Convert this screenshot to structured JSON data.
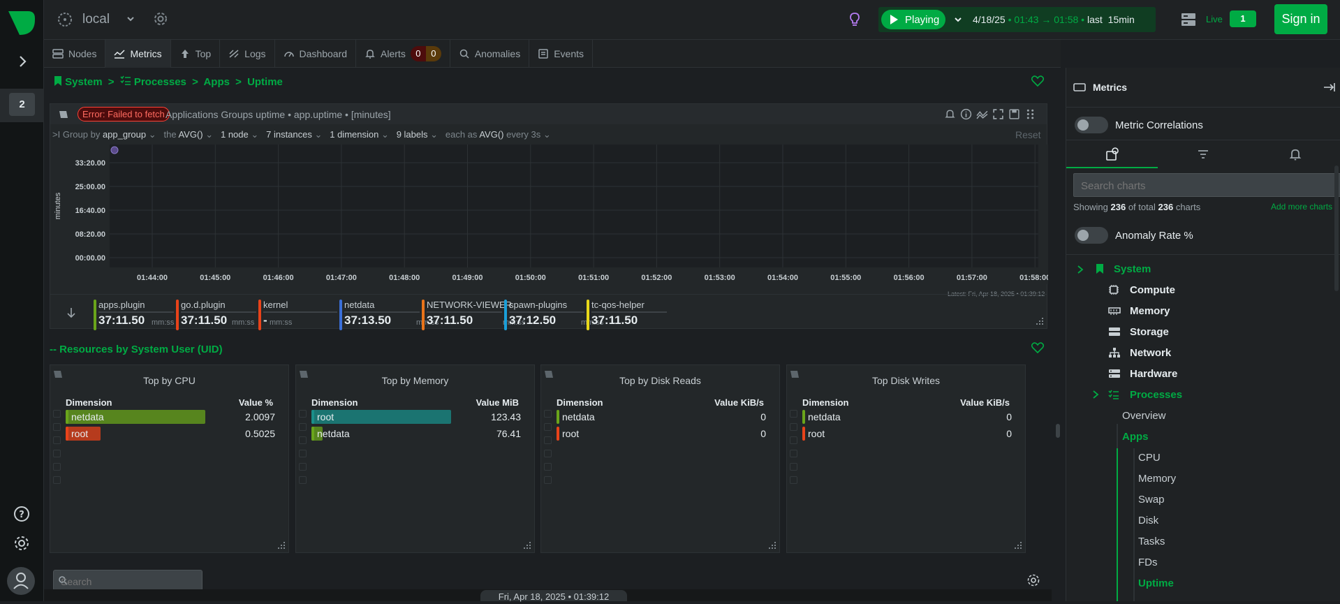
{
  "app": {
    "space_count": "2",
    "room_name": "local",
    "playing_label": "Playing",
    "time_range": {
      "date": "4/18/25",
      "start": "01:43",
      "end": "01:58",
      "last": "last",
      "duration": "15min"
    },
    "live_label": "Live",
    "live_count": "1",
    "signin_label": "Sign in"
  },
  "tabs": [
    {
      "label": "Nodes",
      "icon": "nodes-icon"
    },
    {
      "label": "Metrics",
      "icon": "metrics-icon"
    },
    {
      "label": "Top",
      "icon": "top-icon"
    },
    {
      "label": "Logs",
      "icon": "logs-icon"
    },
    {
      "label": "Dashboard",
      "icon": "dashboard-icon"
    },
    {
      "label": "Alerts",
      "icon": "bell-icon",
      "critical": "0",
      "warning": "0"
    },
    {
      "label": "Anomalies",
      "icon": "anomalies-icon"
    },
    {
      "label": "Events",
      "icon": "events-icon"
    }
  ],
  "breadcrumb": {
    "system": "System",
    "processes": "Processes",
    "apps": "Apps",
    "uptime": "Uptime"
  },
  "chart": {
    "error": "Error: Failed to fetch",
    "title": "Applications Groups uptime • app.uptime • [minutes]",
    "toolbar": {
      "group_by_prefix": "Group by",
      "group_by": "app_group",
      "agg_prefix": "the",
      "agg": "AVG()",
      "nodes": "1 node",
      "instances": "7 instances",
      "dimensions": "1 dimension",
      "labels": "9 labels",
      "each_as_prefix": "each as",
      "each_as": "AVG()",
      "every": "every 3s",
      "reset": "Reset"
    },
    "latest": "Latest:  Fri, Apr 18, 2025 • 01:39:12",
    "legend_unit": "mm:ss",
    "legend": [
      {
        "name": "apps.plugin",
        "value": "37:11.50",
        "color": "#6aa51b"
      },
      {
        "name": "go.d.plugin",
        "value": "37:11.50",
        "color": "#e8431a"
      },
      {
        "name": "kernel",
        "value": "-",
        "color": "#e8431a"
      },
      {
        "name": "netdata",
        "value": "37:13.50",
        "color": "#3a6fd8"
      },
      {
        "name": "NETWORK-VIEWER",
        "value": "37:11.50",
        "color": "#e8731a"
      },
      {
        "name": "spawn-plugins",
        "value": "37:12.50",
        "color": "#1a9fd8"
      },
      {
        "name": "tc-qos-helper",
        "value": "37:11.50",
        "color": "#e8d81a"
      }
    ]
  },
  "chart_data": {
    "type": "line",
    "title": "Applications Groups uptime • app.uptime • [minutes]",
    "ylabel": "minutes",
    "xlabel": "",
    "y_ticks": [
      "00:00.00",
      "08:20.00",
      "16:40.00",
      "25:00.00",
      "33:20.00"
    ],
    "x_ticks": [
      "01:44:00",
      "01:45:00",
      "01:46:00",
      "01:47:00",
      "01:48:00",
      "01:49:00",
      "01:50:00",
      "01:51:00",
      "01:52:00",
      "01:53:00",
      "01:54:00",
      "01:55:00",
      "01:56:00",
      "01:57:00",
      "01:58:00"
    ],
    "series": [],
    "grid": true
  },
  "section": {
    "title": "-- Resources by System User (UID)"
  },
  "tables": [
    {
      "title": "Top by CPU",
      "dim_header": "Dimension",
      "val_header": "Value",
      "unit": "%",
      "rows": [
        {
          "name": "netdata",
          "value": "2.0097",
          "color": "#6aa51b",
          "fraction": 1.0
        },
        {
          "name": "root",
          "value": "0.5025",
          "color": "#e8431a",
          "fraction": 0.25
        }
      ]
    },
    {
      "title": "Top by Memory",
      "dim_header": "Dimension",
      "val_header": "Value",
      "unit": "MiB",
      "rows": [
        {
          "name": "root",
          "value": "123.43",
          "color": "#1a8f8a",
          "fraction": 1.0
        },
        {
          "name": "netdata",
          "value": "76.41",
          "color": "#6aa51b",
          "fraction": 0.05
        }
      ]
    },
    {
      "title": "Top by Disk Reads",
      "dim_header": "Dimension",
      "val_header": "Value",
      "unit": "KiB/s",
      "rows": [
        {
          "name": "netdata",
          "value": "0",
          "color": "#6aa51b",
          "fraction": 0
        },
        {
          "name": "root",
          "value": "0",
          "color": "#e8431a",
          "fraction": 0
        }
      ]
    },
    {
      "title": "Top Disk Writes",
      "dim_header": "Dimension",
      "val_header": "Value",
      "unit": "KiB/s",
      "rows": [
        {
          "name": "netdata",
          "value": "0",
          "color": "#6aa51b",
          "fraction": 0
        },
        {
          "name": "root",
          "value": "0",
          "color": "#e8431a",
          "fraction": 0
        }
      ]
    }
  ],
  "bottom": {
    "search_placeholder": "Search",
    "timestamp": "Fri, Apr 18, 2025 • 01:39:12"
  },
  "sidebar": {
    "title": "Metrics",
    "metric_correlations": "Metric Correlations",
    "search_placeholder": "Search charts",
    "showing_prefix": "Showing",
    "showing_count": "236",
    "showing_mid": "of total",
    "showing_total": "236",
    "showing_suffix": "charts",
    "add_more": "Add more charts",
    "anomaly_rate": "Anomaly Rate %",
    "nav": {
      "system": "System",
      "compute": "Compute",
      "memory": "Memory",
      "storage": "Storage",
      "network": "Network",
      "hardware": "Hardware",
      "processes": "Processes",
      "overview": "Overview",
      "apps": "Apps",
      "apps_items": [
        "CPU",
        "Memory",
        "Swap",
        "Disk",
        "Tasks",
        "FDs",
        "Uptime"
      ]
    }
  },
  "colors": {
    "accent": "#00ab44",
    "error": "#ff4136",
    "bg": "#1c1f22"
  }
}
